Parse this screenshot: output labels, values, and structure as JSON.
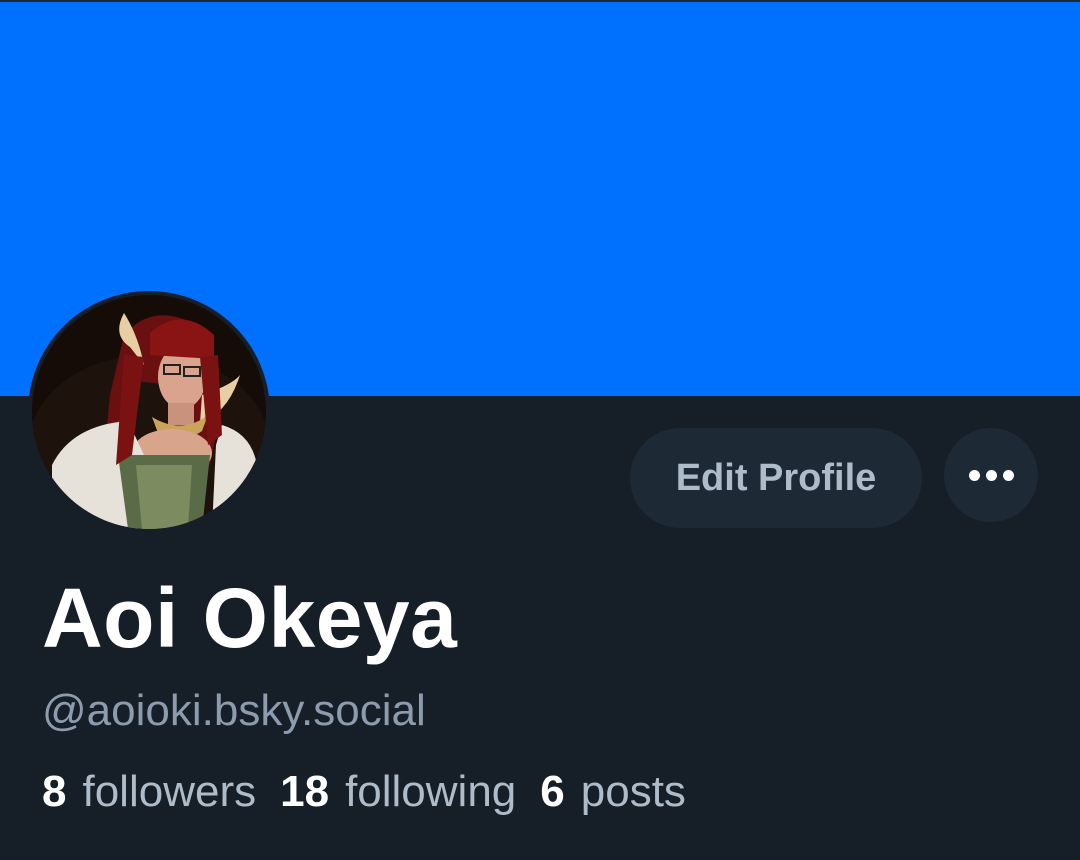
{
  "profile": {
    "banner_color": "#0070ff",
    "avatar_icon": "avatar-image",
    "display_name": "Aoi Okeya",
    "handle": "@aoioki.bsky.social",
    "stats": {
      "followers_count": "8",
      "followers_label": "followers",
      "following_count": "18",
      "following_label": "following",
      "posts_count": "6",
      "posts_label": "posts"
    }
  },
  "actions": {
    "edit_label": "Edit Profile",
    "more_icon": "more-horizontal-icon"
  }
}
